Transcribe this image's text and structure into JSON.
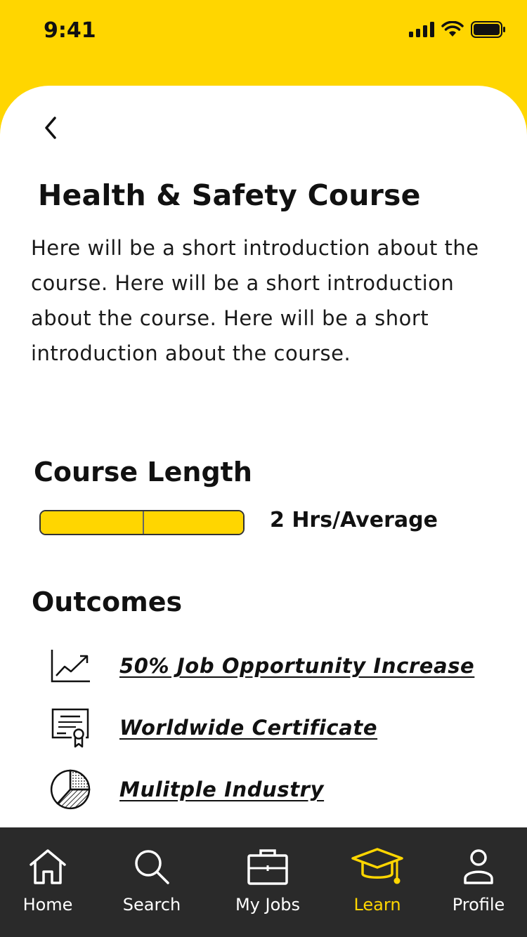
{
  "status_bar": {
    "time": "9:41"
  },
  "page": {
    "title": "Health & Safety Course",
    "intro": "Here will be a short introduction about the course. Here will be a short introduction about the course. Here will be a short introduction about the course."
  },
  "course_length": {
    "heading": "Course Length",
    "value": "2 Hrs/Average",
    "fill_fraction": 1.0
  },
  "outcomes": {
    "heading": "Outcomes",
    "items": [
      {
        "label": "50% Job Opportunity Increase",
        "icon": "trend-chart-icon"
      },
      {
        "label": "Worldwide Certificate",
        "icon": "certificate-icon"
      },
      {
        "label": "Mulitple Industry",
        "icon": "pie-chart-icon"
      }
    ]
  },
  "tabs": [
    {
      "label": "Home",
      "icon": "home-icon",
      "active": false
    },
    {
      "label": "Search",
      "icon": "search-icon",
      "active": false
    },
    {
      "label": "My Jobs",
      "icon": "briefcase-icon",
      "active": false
    },
    {
      "label": "Learn",
      "icon": "graduation-cap-icon",
      "active": true
    },
    {
      "label": "Profile",
      "icon": "profile-icon",
      "active": false
    }
  ],
  "colors": {
    "accent": "#FFD600",
    "tab_bar": "#2A2A2A",
    "text": "#111111"
  }
}
